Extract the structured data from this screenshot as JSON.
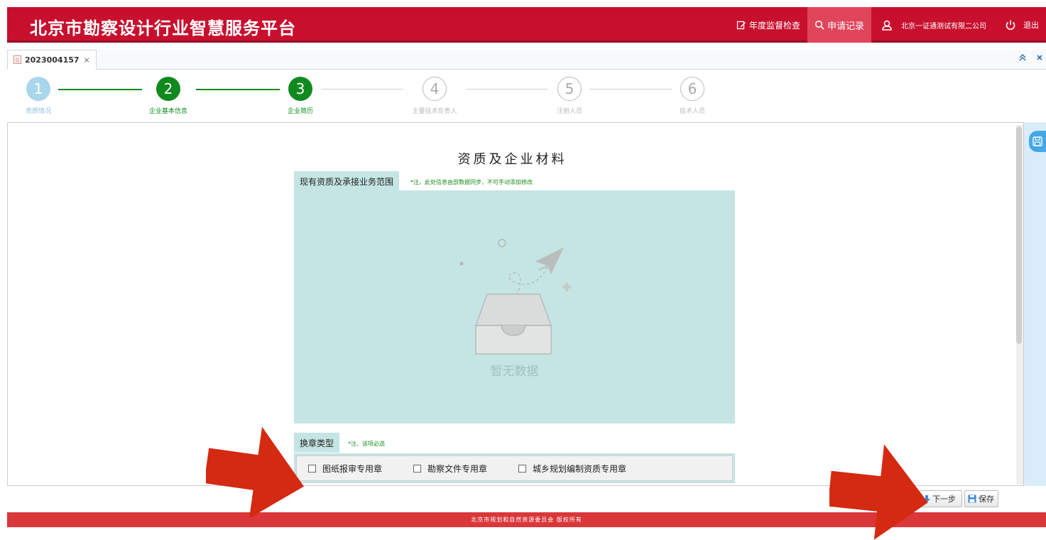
{
  "header": {
    "title": "北京市勘察设计行业智慧服务平台",
    "annual_inspection": "年度监督检查",
    "application_records": "申请记录",
    "company": "北京一证通测试有限二公司",
    "logout": "退出"
  },
  "tab": {
    "label": "2023004157",
    "close": "×"
  },
  "steps": [
    {
      "num": "1",
      "label": "资质情况"
    },
    {
      "num": "2",
      "label": "企业基本信息"
    },
    {
      "num": "3",
      "label": "企业简历"
    },
    {
      "num": "4",
      "label": "主要技术负责人"
    },
    {
      "num": "5",
      "label": "注册人员"
    },
    {
      "num": "6",
      "label": "技术人员"
    }
  ],
  "main": {
    "title": "资质及企业材料",
    "scope_tab": "现有资质及承接业务范围",
    "scope_note": "*注，此处信息由部数据同步，不可手动添加修改",
    "empty_text": "暂无数据",
    "seal_tab": "换章类型",
    "seal_note": "*注，该项必选",
    "seal_options": [
      "图纸报审专用章",
      "勘察文件专用章",
      "城乡规划编制资质专用章"
    ]
  },
  "buttons": {
    "next": "下一步",
    "save": "保存"
  },
  "footer": {
    "text": "北京市规划和自然资源委员会  版权所有"
  },
  "colors": {
    "header_red": "#c8102e",
    "step_green": "#108a1e",
    "panel_teal": "#c4e5e3",
    "arrow_red": "#d42a12"
  }
}
